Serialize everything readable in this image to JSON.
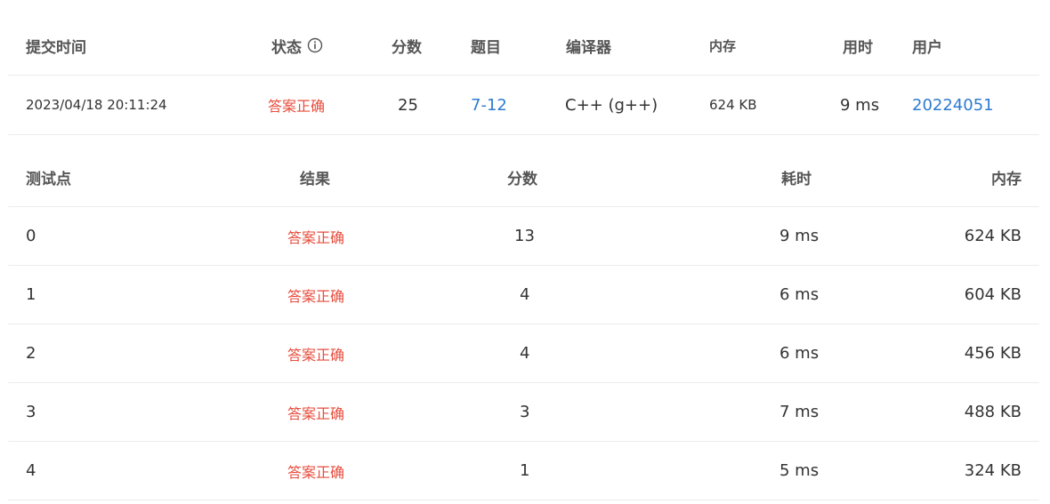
{
  "summary": {
    "headers": {
      "submit_time": "提交时间",
      "status": "状态",
      "score": "分数",
      "problem": "题目",
      "compiler": "编译器",
      "memory": "内存",
      "time_used": "用时",
      "user": "用户"
    },
    "row": {
      "submit_time": "2023/04/18 20:11:24",
      "status": "答案正确",
      "score": "25",
      "problem": "7-12",
      "compiler": "C++ (g++)",
      "memory": "624 KB",
      "time_used": "9 ms",
      "user": "20224051"
    }
  },
  "cases": {
    "headers": {
      "point": "测试点",
      "result": "结果",
      "score": "分数",
      "time": "耗时",
      "memory": "内存"
    },
    "rows": [
      {
        "point": "0",
        "result": "答案正确",
        "score": "13",
        "time": "9 ms",
        "memory": "624 KB"
      },
      {
        "point": "1",
        "result": "答案正确",
        "score": "4",
        "time": "6 ms",
        "memory": "604 KB"
      },
      {
        "point": "2",
        "result": "答案正确",
        "score": "4",
        "time": "6 ms",
        "memory": "456 KB"
      },
      {
        "point": "3",
        "result": "答案正确",
        "score": "3",
        "time": "7 ms",
        "memory": "488 KB"
      },
      {
        "point": "4",
        "result": "答案正确",
        "score": "1",
        "time": "5 ms",
        "memory": "324 KB"
      }
    ]
  },
  "colors": {
    "status_ok": "#e74c3c",
    "link": "#2e7bcf",
    "divider": "#ebebeb"
  },
  "icons": {
    "status_info": "info-circle-icon"
  }
}
